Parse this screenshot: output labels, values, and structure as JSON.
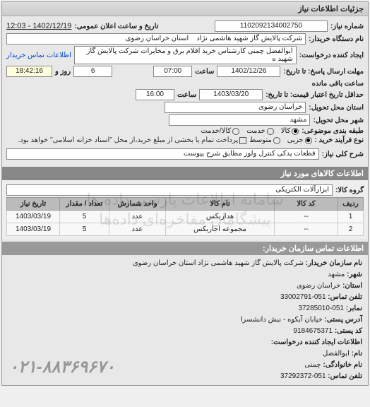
{
  "panel_title": "جزئیات اطلاعات نیاز",
  "form": {
    "req_no_label": "شماره نیاز:",
    "req_no": "1102092134002750",
    "announce_label": "تاریخ و ساعت اعلان عمومی:",
    "announce_value": "1402/12/19 - 12:03",
    "buyer_org_label": "نام دستگاه خریدار:",
    "buyer_org": "شرکت پالایش گاز شهید هاشمی نژاد",
    "province_label": "استان خراسان رضوی",
    "creator_label": "ایجاد کننده درخواست:",
    "creator": "ابوالفضل چمنی کارشناس خرید اقلام برق و مخابرات شرکت پالایش گاز شهید ه",
    "creator_link": "اطلاعات تماس خریدار",
    "resp_deadline_label": "مهلت ارسال پاسخ: تا تاریخ:",
    "resp_date": "1402/12/26",
    "resp_time_label": "ساعت",
    "resp_time": "07:00",
    "remaining_label_prefix": "روز و",
    "remaining_days": "6",
    "remaining_time": "18:42:16",
    "remaining_suffix": "ساعت باقی مانده",
    "validity_label": "حداقل تاریخ اعتبار قیمت: تا تاریخ:",
    "validity_date": "1403/03/20",
    "validity_time_label": "ساعت",
    "validity_time": "16:00",
    "deliv_prov_label": "استان محل تحویل:",
    "deliv_prov": "خراسان رضوی",
    "deliv_city_label": "شهر محل تحویل:",
    "deliv_city": "مشهد",
    "pkg_label": "طبقه بندی موضوعی:",
    "radio_goods": "کالا",
    "radio_service": "خدمت",
    "radio_goods_service": "کالا/خدمت",
    "purchase_size_label": "نوع فرآیند خرید :",
    "radio_small": "جزیی",
    "radio_medium": "متوسط",
    "checkbox_note": "پرداخت تمام یا بخشی از مبلغ خرید،از محل \"اسناد خزانه اسلامی\" خواهد بود.",
    "desc_label": "شرح کلی نیاز:",
    "desc_value": "قطعات یدکی کنترل ولوز مطابق شرح پیوست"
  },
  "items_section_title": "اطلاعات کالاهای مورد نیاز",
  "group_label": "گروه کالا:",
  "group_value": "ابزارآلات الکتریکی",
  "table": {
    "headers": {
      "row": "ردیف",
      "code": "کد کالا",
      "name": "نام کالا",
      "unit": "واحد شمارش",
      "qty": "تعداد / مقدار",
      "date": "تاریخ نیاز"
    },
    "rows": [
      {
        "row": "1",
        "code": "--",
        "name": "هداربکس",
        "unit": "عدد",
        "qty": "5",
        "date": "1403/03/19"
      },
      {
        "row": "2",
        "code": "--",
        "name": "مجموعه اجاربکس",
        "unit": "عدد",
        "qty": "5",
        "date": "1403/03/19"
      }
    ]
  },
  "watermark_line1": "سامانه اطلاعات پارسی داده ها",
  "watermark_line2": "پیشگامان مفاخره‌ای داده‌ها",
  "contact_title": "اطلاعات تماس سازمان خریدار:",
  "contact": {
    "org_label": "نام سازمان خریدار:",
    "org": "شرکت پالایش گاز شهید هاشمی نژاد استان خراسان رضوی",
    "city_label": "شهر:",
    "city": "مشهد",
    "province_label": "استان:",
    "province": "خراسان رضوی",
    "phone_label": "تلفن تماس:",
    "phone": "051-33002791",
    "fax_label": "نمابر:",
    "fax": "051-37285010",
    "postal_addr_label": "آدرس پستی:",
    "postal_addr": "خیابان آبکوه - نبش دانشسرا",
    "postal_code_label": "کد پستی:",
    "postal_code": "9184675371",
    "creator_section": "اطلاعات ایجاد کننده درخواست:",
    "name_label": "نام:",
    "name": "ابوالفضل",
    "surname_label": "نام خانوادگی:",
    "surname": "چمنی",
    "phone2_label": "تلفن تماس:",
    "phone2": "051-37292372"
  },
  "footer_phone": "۰۲۱-۸۸۳۶۹۶۷۰"
}
